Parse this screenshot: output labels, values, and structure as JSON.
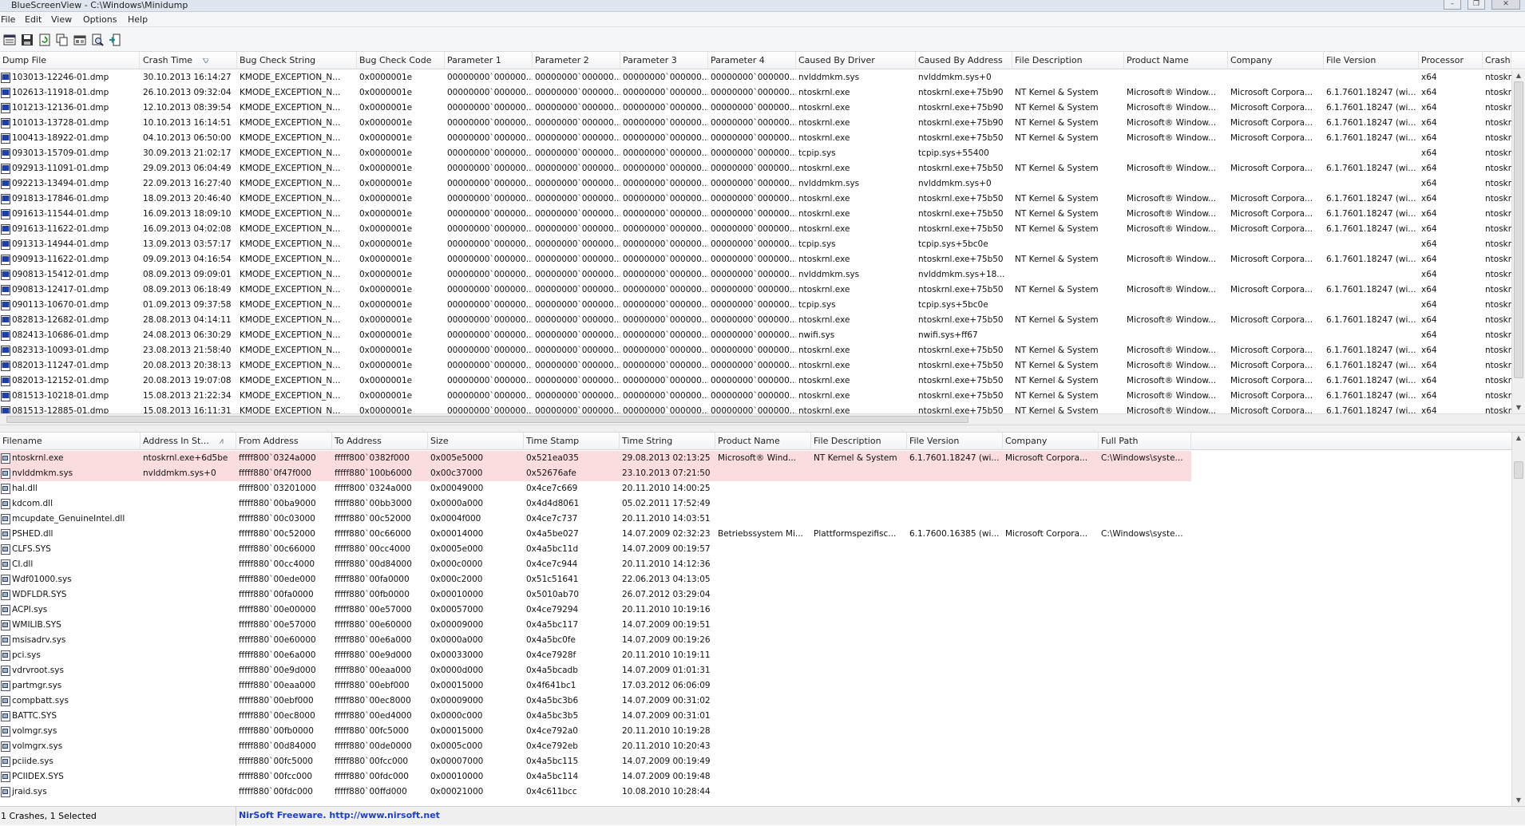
{
  "window": {
    "title": "BlueScreenView  -  C:\\Windows\\Minidump",
    "minimize_glyph": "–",
    "maximize_glyph": "❐",
    "close_glyph": "✕"
  },
  "menu": [
    "File",
    "Edit",
    "View",
    "Options",
    "Help"
  ],
  "toolbar": {
    "icons": [
      "properties-icon",
      "save-icon",
      "refresh-icon",
      "copy-icon",
      "html-report-icon",
      "find-icon",
      "exit-icon"
    ]
  },
  "upper": {
    "sort_column": "Crash Time",
    "columns": [
      "Dump File",
      "Crash Time",
      "Bug Check String",
      "Bug Check Code",
      "Parameter 1",
      "Parameter 2",
      "Parameter 3",
      "Parameter 4",
      "Caused By Driver",
      "Caused By Address",
      "File Description",
      "Product Name",
      "Company",
      "File Version",
      "Processor",
      "Crash A"
    ],
    "rows": [
      [
        "103013-12246-01.dmp",
        "30.10.2013 16:14:27",
        "KMODE_EXCEPTION_N...",
        "0x0000001e",
        "00000000`000000...",
        "00000000`000000...",
        "00000000`000000...",
        "00000000`000000...",
        "nvlddmkm.sys",
        "nvlddmkm.sys+0",
        "",
        "",
        "",
        "",
        "x64",
        "ntoskr"
      ],
      [
        "102613-11918-01.dmp",
        "26.10.2013 09:32:04",
        "KMODE_EXCEPTION_N...",
        "0x0000001e",
        "00000000`000000...",
        "00000000`000000...",
        "00000000`000000...",
        "00000000`000000...",
        "ntoskrnl.exe",
        "ntoskrnl.exe+75b90",
        "NT Kernel & System",
        "Microsoft® Window...",
        "Microsoft Corpora...",
        "6.1.7601.18247 (wi...",
        "x64",
        "ntoskr"
      ],
      [
        "101213-12136-01.dmp",
        "12.10.2013 08:39:54",
        "KMODE_EXCEPTION_N...",
        "0x0000001e",
        "00000000`000000...",
        "00000000`000000...",
        "00000000`000000...",
        "00000000`000000...",
        "ntoskrnl.exe",
        "ntoskrnl.exe+75b90",
        "NT Kernel & System",
        "Microsoft® Window...",
        "Microsoft Corpora...",
        "6.1.7601.18247 (wi...",
        "x64",
        "ntoskr"
      ],
      [
        "101013-13728-01.dmp",
        "10.10.2013 16:14:51",
        "KMODE_EXCEPTION_N...",
        "0x0000001e",
        "00000000`000000...",
        "00000000`000000...",
        "00000000`000000...",
        "00000000`000000...",
        "ntoskrnl.exe",
        "ntoskrnl.exe+75b90",
        "NT Kernel & System",
        "Microsoft® Window...",
        "Microsoft Corpora...",
        "6.1.7601.18247 (wi...",
        "x64",
        "ntoskr"
      ],
      [
        "100413-18922-01.dmp",
        "04.10.2013 06:50:00",
        "KMODE_EXCEPTION_N...",
        "0x0000001e",
        "00000000`000000...",
        "00000000`000000...",
        "00000000`000000...",
        "00000000`000000...",
        "ntoskrnl.exe",
        "ntoskrnl.exe+75b50",
        "NT Kernel & System",
        "Microsoft® Window...",
        "Microsoft Corpora...",
        "6.1.7601.18247 (wi...",
        "x64",
        "ntoskr"
      ],
      [
        "093013-15709-01.dmp",
        "30.09.2013 21:02:17",
        "KMODE_EXCEPTION_N...",
        "0x0000001e",
        "00000000`000000...",
        "00000000`000000...",
        "00000000`000000...",
        "00000000`000000...",
        "tcpip.sys",
        "tcpip.sys+55400",
        "",
        "",
        "",
        "",
        "x64",
        "ntoskr"
      ],
      [
        "092913-11091-01.dmp",
        "29.09.2013 06:04:49",
        "KMODE_EXCEPTION_N...",
        "0x0000001e",
        "00000000`000000...",
        "00000000`000000...",
        "00000000`000000...",
        "00000000`000000...",
        "ntoskrnl.exe",
        "ntoskrnl.exe+75b50",
        "NT Kernel & System",
        "Microsoft® Window...",
        "Microsoft Corpora...",
        "6.1.7601.18247 (wi...",
        "x64",
        "ntoskr"
      ],
      [
        "092213-13494-01.dmp",
        "22.09.2013 16:27:40",
        "KMODE_EXCEPTION_N...",
        "0x0000001e",
        "00000000`000000...",
        "00000000`000000...",
        "00000000`000000...",
        "00000000`000000...",
        "nvlddmkm.sys",
        "nvlddmkm.sys+0",
        "",
        "",
        "",
        "",
        "x64",
        "ntoskr"
      ],
      [
        "091813-17846-01.dmp",
        "18.09.2013 20:46:40",
        "KMODE_EXCEPTION_N...",
        "0x0000001e",
        "00000000`000000...",
        "00000000`000000...",
        "00000000`000000...",
        "00000000`000000...",
        "ntoskrnl.exe",
        "ntoskrnl.exe+75b50",
        "NT Kernel & System",
        "Microsoft® Window...",
        "Microsoft Corpora...",
        "6.1.7601.18247 (wi...",
        "x64",
        "ntoskr"
      ],
      [
        "091613-11544-01.dmp",
        "16.09.2013 18:09:10",
        "KMODE_EXCEPTION_N...",
        "0x0000001e",
        "00000000`000000...",
        "00000000`000000...",
        "00000000`000000...",
        "00000000`000000...",
        "ntoskrnl.exe",
        "ntoskrnl.exe+75b50",
        "NT Kernel & System",
        "Microsoft® Window...",
        "Microsoft Corpora...",
        "6.1.7601.18247 (wi...",
        "x64",
        "ntoskr"
      ],
      [
        "091613-11622-01.dmp",
        "16.09.2013 04:02:08",
        "KMODE_EXCEPTION_N...",
        "0x0000001e",
        "00000000`000000...",
        "00000000`000000...",
        "00000000`000000...",
        "00000000`000000...",
        "ntoskrnl.exe",
        "ntoskrnl.exe+75b50",
        "NT Kernel & System",
        "Microsoft® Window...",
        "Microsoft Corpora...",
        "6.1.7601.18247 (wi...",
        "x64",
        "ntoskr"
      ],
      [
        "091313-14944-01.dmp",
        "13.09.2013 03:57:17",
        "KMODE_EXCEPTION_N...",
        "0x0000001e",
        "00000000`000000...",
        "00000000`000000...",
        "00000000`000000...",
        "00000000`000000...",
        "tcpip.sys",
        "tcpip.sys+5bc0e",
        "",
        "",
        "",
        "",
        "x64",
        "ntoskr"
      ],
      [
        "090913-11622-01.dmp",
        "09.09.2013 04:16:54",
        "KMODE_EXCEPTION_N...",
        "0x0000001e",
        "00000000`000000...",
        "00000000`000000...",
        "00000000`000000...",
        "00000000`000000...",
        "ntoskrnl.exe",
        "ntoskrnl.exe+75b50",
        "NT Kernel & System",
        "Microsoft® Window...",
        "Microsoft Corpora...",
        "6.1.7601.18247 (wi...",
        "x64",
        "ntoskr"
      ],
      [
        "090813-15412-01.dmp",
        "08.09.2013 09:09:01",
        "KMODE_EXCEPTION_N...",
        "0x0000001e",
        "00000000`000000...",
        "00000000`000000...",
        "00000000`000000...",
        "00000000`000000...",
        "nvlddmkm.sys",
        "nvlddmkm.sys+18...",
        "",
        "",
        "",
        "",
        "x64",
        "ntoskr"
      ],
      [
        "090813-12417-01.dmp",
        "08.09.2013 06:18:49",
        "KMODE_EXCEPTION_N...",
        "0x0000001e",
        "00000000`000000...",
        "00000000`000000...",
        "00000000`000000...",
        "00000000`000000...",
        "ntoskrnl.exe",
        "ntoskrnl.exe+75b50",
        "NT Kernel & System",
        "Microsoft® Window...",
        "Microsoft Corpora...",
        "6.1.7601.18247 (wi...",
        "x64",
        "ntoskr"
      ],
      [
        "090113-10670-01.dmp",
        "01.09.2013 09:37:58",
        "KMODE_EXCEPTION_N...",
        "0x0000001e",
        "00000000`000000...",
        "00000000`000000...",
        "00000000`000000...",
        "00000000`000000...",
        "tcpip.sys",
        "tcpip.sys+5bc0e",
        "",
        "",
        "",
        "",
        "x64",
        "ntoskr"
      ],
      [
        "082813-12682-01.dmp",
        "28.08.2013 04:14:11",
        "KMODE_EXCEPTION_N...",
        "0x0000001e",
        "00000000`000000...",
        "00000000`000000...",
        "00000000`000000...",
        "00000000`000000...",
        "ntoskrnl.exe",
        "ntoskrnl.exe+75b50",
        "NT Kernel & System",
        "Microsoft® Window...",
        "Microsoft Corpora...",
        "6.1.7601.18247 (wi...",
        "x64",
        "ntoskr"
      ],
      [
        "082413-10686-01.dmp",
        "24.08.2013 06:30:29",
        "KMODE_EXCEPTION_N...",
        "0x0000001e",
        "00000000`000000...",
        "00000000`000000...",
        "00000000`000000...",
        "00000000`000000...",
        "nwifi.sys",
        "nwifi.sys+ff67",
        "",
        "",
        "",
        "",
        "x64",
        "ntoskr"
      ],
      [
        "082313-10093-01.dmp",
        "23.08.2013 21:58:40",
        "KMODE_EXCEPTION_N...",
        "0x0000001e",
        "00000000`000000...",
        "00000000`000000...",
        "00000000`000000...",
        "00000000`000000...",
        "ntoskrnl.exe",
        "ntoskrnl.exe+75b50",
        "NT Kernel & System",
        "Microsoft® Window...",
        "Microsoft Corpora...",
        "6.1.7601.18247 (wi...",
        "x64",
        "ntoskr"
      ],
      [
        "082013-11247-01.dmp",
        "20.08.2013 20:38:13",
        "KMODE_EXCEPTION_N...",
        "0x0000001e",
        "00000000`000000...",
        "00000000`000000...",
        "00000000`000000...",
        "00000000`000000...",
        "ntoskrnl.exe",
        "ntoskrnl.exe+75b50",
        "NT Kernel & System",
        "Microsoft® Window...",
        "Microsoft Corpora...",
        "6.1.7601.18247 (wi...",
        "x64",
        "ntoskr"
      ],
      [
        "082013-12152-01.dmp",
        "20.08.2013 19:07:08",
        "KMODE_EXCEPTION_N...",
        "0x0000001e",
        "00000000`000000...",
        "00000000`000000...",
        "00000000`000000...",
        "00000000`000000...",
        "ntoskrnl.exe",
        "ntoskrnl.exe+75b50",
        "NT Kernel & System",
        "Microsoft® Window...",
        "Microsoft Corpora...",
        "6.1.7601.18247 (wi...",
        "x64",
        "ntoskr"
      ],
      [
        "081513-10218-01.dmp",
        "15.08.2013 21:22:34",
        "KMODE_EXCEPTION_N...",
        "0x0000001e",
        "00000000`000000...",
        "00000000`000000...",
        "00000000`000000...",
        "00000000`000000...",
        "ntoskrnl.exe",
        "ntoskrnl.exe+75b50",
        "NT Kernel & System",
        "Microsoft® Window...",
        "Microsoft Corpora...",
        "6.1.7601.18247 (wi...",
        "x64",
        "ntoskr"
      ],
      [
        "081513-12885-01.dmp",
        "15.08.2013 16:11:31",
        "KMODE_EXCEPTION_N...",
        "0x0000001e",
        "00000000`000000...",
        "00000000`000000...",
        "00000000`000000...",
        "00000000`000000...",
        "ntoskrnl.exe",
        "ntoskrnl.exe+75b50",
        "NT Kernel & System",
        "Microsoft® Window...",
        "Microsoft Corpora...",
        "6.1.7601.18247 (wi...",
        "x64",
        "ntoskr"
      ]
    ]
  },
  "lower": {
    "sort_column": "Address In St...",
    "columns": [
      "Filename",
      "Address In St...",
      "From Address",
      "To Address",
      "Size",
      "Time Stamp",
      "Time String",
      "Product Name",
      "File Description",
      "File Version",
      "Company",
      "Full Path"
    ],
    "rows": [
      [
        "ntoskrnl.exe",
        "ntoskrnl.exe+6d5be",
        "fffff800`0324a000",
        "fffff800`0382f000",
        "0x005e5000",
        "0x521ea035",
        "29.08.2013 02:13:25",
        "Microsoft® Wind...",
        "NT Kernel & System",
        "6.1.7601.18247 (wi...",
        "Microsoft Corpora...",
        "C:\\Windows\\syste..."
      ],
      [
        "nvlddmkm.sys",
        "nvlddmkm.sys+0",
        "fffff880`0f47f000",
        "fffff880`100b6000",
        "0x00c37000",
        "0x52676afe",
        "23.10.2013 07:21:50",
        "",
        "",
        "",
        "",
        ""
      ],
      [
        "hal.dll",
        "",
        "fffff800`03201000",
        "fffff800`0324a000",
        "0x00049000",
        "0x4ce7c669",
        "20.11.2010 14:00:25",
        "",
        "",
        "",
        "",
        ""
      ],
      [
        "kdcom.dll",
        "",
        "fffff880`00ba9000",
        "fffff880`00bb3000",
        "0x0000a000",
        "0x4d4d8061",
        "05.02.2011 17:52:49",
        "",
        "",
        "",
        "",
        ""
      ],
      [
        "mcupdate_GenuineIntel.dll",
        "",
        "fffff880`00c03000",
        "fffff880`00c52000",
        "0x0004f000",
        "0x4ce7c737",
        "20.11.2010 14:03:51",
        "",
        "",
        "",
        "",
        ""
      ],
      [
        "PSHED.dll",
        "",
        "fffff880`00c52000",
        "fffff880`00c66000",
        "0x00014000",
        "0x4a5be027",
        "14.07.2009 02:32:23",
        "Betriebssystem Mi...",
        "Plattformspezifisc...",
        "6.1.7600.16385 (wi...",
        "Microsoft Corpora...",
        "C:\\Windows\\syste..."
      ],
      [
        "CLFS.SYS",
        "",
        "fffff880`00c66000",
        "fffff880`00cc4000",
        "0x0005e000",
        "0x4a5bc11d",
        "14.07.2009 00:19:57",
        "",
        "",
        "",
        "",
        ""
      ],
      [
        "CI.dll",
        "",
        "fffff880`00cc4000",
        "fffff880`00d84000",
        "0x000c0000",
        "0x4ce7c944",
        "20.11.2010 14:12:36",
        "",
        "",
        "",
        "",
        ""
      ],
      [
        "Wdf01000.sys",
        "",
        "fffff880`00ede000",
        "fffff880`00fa0000",
        "0x000c2000",
        "0x51c51641",
        "22.06.2013 04:13:05",
        "",
        "",
        "",
        "",
        ""
      ],
      [
        "WDFLDR.SYS",
        "",
        "fffff880`00fa0000",
        "fffff880`00fb0000",
        "0x00010000",
        "0x5010ab70",
        "26.07.2012 03:29:04",
        "",
        "",
        "",
        "",
        ""
      ],
      [
        "ACPI.sys",
        "",
        "fffff880`00e00000",
        "fffff880`00e57000",
        "0x00057000",
        "0x4ce79294",
        "20.11.2010 10:19:16",
        "",
        "",
        "",
        "",
        ""
      ],
      [
        "WMILIB.SYS",
        "",
        "fffff880`00e57000",
        "fffff880`00e60000",
        "0x00009000",
        "0x4a5bc117",
        "14.07.2009 00:19:51",
        "",
        "",
        "",
        "",
        ""
      ],
      [
        "msisadrv.sys",
        "",
        "fffff880`00e60000",
        "fffff880`00e6a000",
        "0x0000a000",
        "0x4a5bc0fe",
        "14.07.2009 00:19:26",
        "",
        "",
        "",
        "",
        ""
      ],
      [
        "pci.sys",
        "",
        "fffff880`00e6a000",
        "fffff880`00e9d000",
        "0x00033000",
        "0x4ce7928f",
        "20.11.2010 10:19:11",
        "",
        "",
        "",
        "",
        ""
      ],
      [
        "vdrvroot.sys",
        "",
        "fffff880`00e9d000",
        "fffff880`00eaa000",
        "0x0000d000",
        "0x4a5bcadb",
        "14.07.2009 01:01:31",
        "",
        "",
        "",
        "",
        ""
      ],
      [
        "partmgr.sys",
        "",
        "fffff880`00eaa000",
        "fffff880`00ebf000",
        "0x00015000",
        "0x4f641bc1",
        "17.03.2012 06:06:09",
        "",
        "",
        "",
        "",
        ""
      ],
      [
        "compbatt.sys",
        "",
        "fffff880`00ebf000",
        "fffff880`00ec8000",
        "0x00009000",
        "0x4a5bc3b6",
        "14.07.2009 00:31:02",
        "",
        "",
        "",
        "",
        ""
      ],
      [
        "BATTC.SYS",
        "",
        "fffff880`00ec8000",
        "fffff880`00ed4000",
        "0x0000c000",
        "0x4a5bc3b5",
        "14.07.2009 00:31:01",
        "",
        "",
        "",
        "",
        ""
      ],
      [
        "volmgr.sys",
        "",
        "fffff880`00fb0000",
        "fffff880`00fc5000",
        "0x00015000",
        "0x4ce792a0",
        "20.11.2010 10:19:28",
        "",
        "",
        "",
        "",
        ""
      ],
      [
        "volmgrx.sys",
        "",
        "fffff880`00d84000",
        "fffff880`00de0000",
        "0x0005c000",
        "0x4ce792eb",
        "20.11.2010 10:20:43",
        "",
        "",
        "",
        "",
        ""
      ],
      [
        "pciide.sys",
        "",
        "fffff880`00fc5000",
        "fffff880`00fcc000",
        "0x00007000",
        "0x4a5bc115",
        "14.07.2009 00:19:49",
        "",
        "",
        "",
        "",
        ""
      ],
      [
        "PCIIDEX.SYS",
        "",
        "fffff880`00fcc000",
        "fffff880`00fdc000",
        "0x00010000",
        "0x4a5bc114",
        "14.07.2009 00:19:48",
        "",
        "",
        "",
        "",
        ""
      ],
      [
        "jraid.sys",
        "",
        "fffff880`00fdc000",
        "fffff880`00ffd000",
        "0x00021000",
        "0x4c611bcc",
        "10.08.2010 10:28:44",
        "",
        "",
        "",
        "",
        ""
      ]
    ]
  },
  "status": {
    "left": "1 Crashes, 1 Selected",
    "right": "NirSoft Freeware.  http://www.nirsoft.net"
  },
  "colors": {
    "highlight_row": "#fbdde0",
    "accent_link": "#1a3fd0",
    "dump_icon": "#1f3fa8"
  }
}
